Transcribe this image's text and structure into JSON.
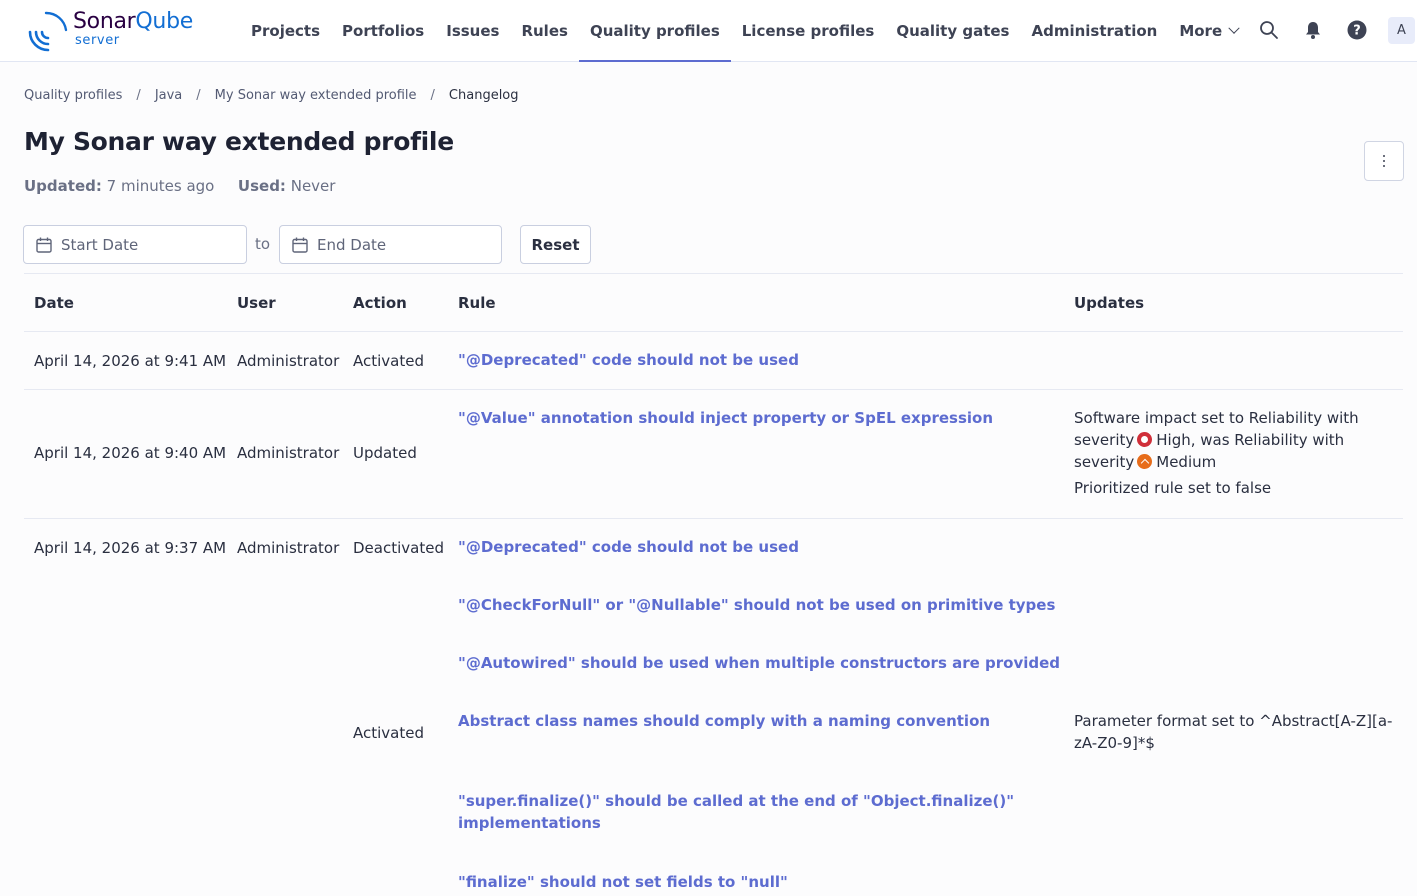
{
  "app": {
    "brand_main": "Sonar",
    "brand_q": "Qube",
    "brand_sub": "server"
  },
  "nav": {
    "items": [
      "Projects",
      "Portfolios",
      "Issues",
      "Rules",
      "Quality profiles",
      "License profiles",
      "Quality gates",
      "Administration",
      "More"
    ],
    "active": "Quality profiles",
    "avatar_initial": "A",
    "icons": [
      "search-icon",
      "bell-icon",
      "help-icon"
    ]
  },
  "breadcrumb": [
    "Quality profiles",
    "Java",
    "My Sonar way extended profile",
    "Changelog"
  ],
  "page": {
    "title": "My Sonar way extended profile",
    "updated_label": "Updated:",
    "updated_value": "7 minutes ago",
    "used_label": "Used:",
    "used_value": "Never"
  },
  "filters": {
    "start_placeholder": "Start Date",
    "to_label": "to",
    "end_placeholder": "End Date",
    "reset_label": "Reset"
  },
  "table": {
    "headers": [
      "Date",
      "User",
      "Action",
      "Rule",
      "Updates"
    ],
    "rows": [
      {
        "date": "April 14, 2026 at 9:41 AM",
        "user": "Administrator",
        "action": "Activated",
        "rule": "\"@Deprecated\" code should not be used"
      },
      {
        "date": "April 14, 2026 at 9:40 AM",
        "user": "Administrator",
        "action": "Updated",
        "rule": "\"@Value\" annotation should inject property or SpEL expression",
        "update_line1": "Software impact set to Reliability with",
        "update_line2_a": "severity",
        "update_line2_b": "High, was Reliability with",
        "update_line3_a": "severity",
        "update_line3_b": "Medium",
        "update_line4": "Prioritized rule set to false"
      },
      {
        "date": "April 14, 2026 at 9:37 AM",
        "user": "Administrator",
        "action_deactivated": "Deactivated",
        "deactivated_rules": [
          "\"@Deprecated\" code should not be used",
          "\"@CheckForNull\" or \"@Nullable\" should not be used on primitive types",
          "\"@Autowired\" should be used when multiple constructors are provided"
        ],
        "action_activated": "Activated",
        "activated_rules": [
          "Abstract class names should comply with a naming convention",
          "\"super.finalize()\" should be called at the end of \"Object.finalize()\"",
          "implementations",
          "\"finalize\" should not set fields to \"null\""
        ],
        "param_update_line1": "Parameter format set to ^Abstract[A-Z][a-",
        "param_update_line2": "zA-Z0-9]*$"
      }
    ]
  },
  "colors": {
    "link": "#5d6cd0",
    "severity_high": "#d02f3a",
    "severity_medium": "#e76d1b",
    "nav_active_underline": "#5d6cd0"
  }
}
